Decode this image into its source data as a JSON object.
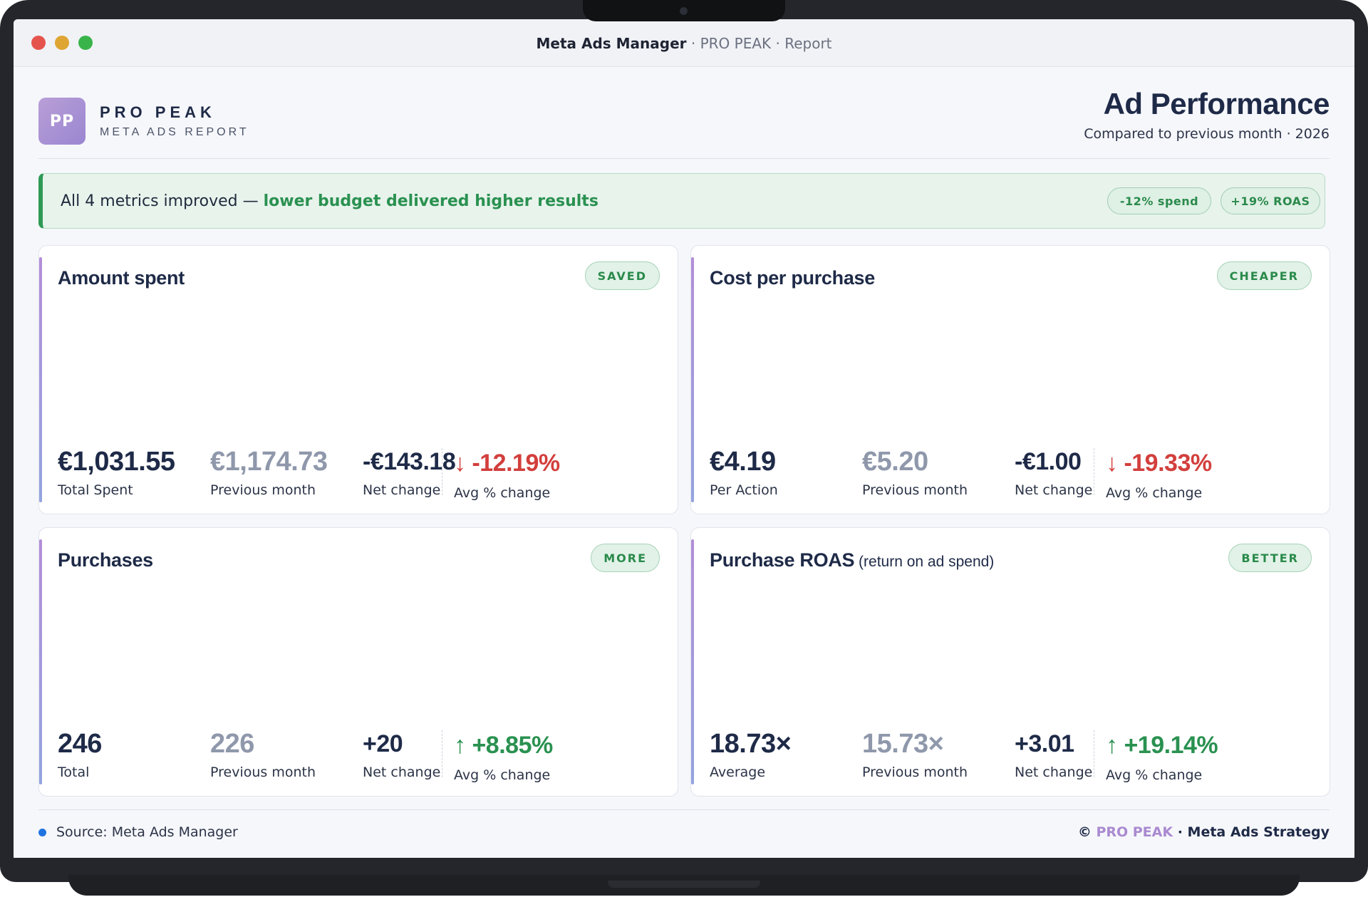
{
  "window": {
    "app_name": "Meta Ads Manager",
    "context": " · PRO PEAK · Report"
  },
  "brand": {
    "logo_initials": "PP",
    "name": "PRO PEAK",
    "subtitle": "META ADS REPORT"
  },
  "report": {
    "title": "Ad Performance",
    "subtitle": "Compared to previous month · 2026"
  },
  "banner": {
    "lead": "All 4 metrics improved — ",
    "highlight": "lower budget delivered higher results",
    "pills": [
      "-12% spend",
      "+19% ROAS"
    ]
  },
  "cards": [
    {
      "title": "Amount spent",
      "title_note": "",
      "badge": "SAVED",
      "current": {
        "value": "€1,031.55",
        "label": "Total Spent"
      },
      "previous": {
        "value": "€1,174.73",
        "label": "Previous month"
      },
      "net": {
        "value": "-€143.18",
        "label": "Net change"
      },
      "change": {
        "arrow": "↓",
        "value": "-12.19%",
        "label": "Avg % change",
        "direction": "down"
      }
    },
    {
      "title": "Cost per purchase",
      "title_note": "",
      "badge": "CHEAPER",
      "current": {
        "value": "€4.19",
        "label": "Per Action"
      },
      "previous": {
        "value": "€5.20",
        "label": "Previous month"
      },
      "net": {
        "value": "-€1.00",
        "label": "Net change"
      },
      "change": {
        "arrow": "↓",
        "value": "-19.33%",
        "label": "Avg % change",
        "direction": "down"
      }
    },
    {
      "title": "Purchases",
      "title_note": "",
      "badge": "MORE",
      "current": {
        "value": "246",
        "label": "Total"
      },
      "previous": {
        "value": "226",
        "label": "Previous month"
      },
      "net": {
        "value": "+20",
        "label": "Net change"
      },
      "change": {
        "arrow": "↑",
        "value": "+8.85%",
        "label": "Avg % change",
        "direction": "up"
      }
    },
    {
      "title": "Purchase ROAS",
      "title_note": " (return on ad spend)",
      "badge": "BETTER",
      "current": {
        "value": "18.73×",
        "label": "Average"
      },
      "previous": {
        "value": "15.73×",
        "label": "Previous month"
      },
      "net": {
        "value": "+3.01",
        "label": "Net change"
      },
      "change": {
        "arrow": "↑",
        "value": "+19.14%",
        "label": "Avg % change",
        "direction": "up"
      }
    }
  ],
  "footer": {
    "source": "Source: Meta Ads Manager",
    "copyright_symbol": "© ",
    "copyright_brand": "PRO PEAK",
    "copyright_rest": " · Meta Ads Strategy"
  },
  "colors": {
    "accent_purple": "#a98ad0",
    "positive": "#2a9150",
    "negative": "#d23f3c",
    "navy": "#1e2a47"
  }
}
